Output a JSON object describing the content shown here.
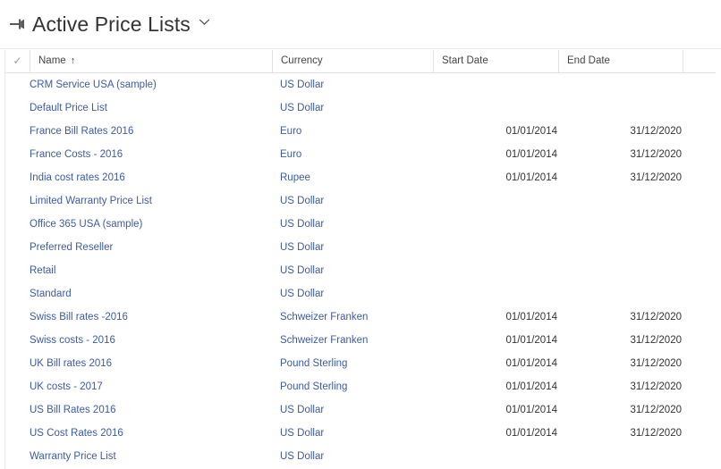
{
  "header": {
    "pin_icon": "pin-icon",
    "title": "Active Price Lists",
    "chevron_icon": "chevron-down-icon"
  },
  "grid": {
    "columns": {
      "select_all_icon": "checkmark-icon",
      "name": "Name",
      "sort_indicator": "↑",
      "currency": "Currency",
      "start_date": "Start Date",
      "end_date": "End Date"
    },
    "rows": [
      {
        "name": "CRM Service USA (sample)",
        "currency": "US Dollar",
        "start_date": "",
        "end_date": ""
      },
      {
        "name": "Default Price List",
        "currency": "US Dollar",
        "start_date": "",
        "end_date": ""
      },
      {
        "name": "France Bill Rates 2016",
        "currency": "Euro",
        "start_date": "01/01/2014",
        "end_date": "31/12/2020"
      },
      {
        "name": "France Costs - 2016",
        "currency": "Euro",
        "start_date": "01/01/2014",
        "end_date": "31/12/2020"
      },
      {
        "name": "India cost rates 2016",
        "currency": "Rupee",
        "start_date": "01/01/2014",
        "end_date": "31/12/2020"
      },
      {
        "name": "Limited Warranty Price List",
        "currency": "US Dollar",
        "start_date": "",
        "end_date": ""
      },
      {
        "name": "Office 365 USA (sample)",
        "currency": "US Dollar",
        "start_date": "",
        "end_date": ""
      },
      {
        "name": "Preferred Reseller",
        "currency": "US Dollar",
        "start_date": "",
        "end_date": ""
      },
      {
        "name": "Retail",
        "currency": "US Dollar",
        "start_date": "",
        "end_date": ""
      },
      {
        "name": "Standard",
        "currency": "US Dollar",
        "start_date": "",
        "end_date": ""
      },
      {
        "name": "Swiss Bill rates -2016",
        "currency": "Schweizer Franken",
        "start_date": "01/01/2014",
        "end_date": "31/12/2020"
      },
      {
        "name": "Swiss costs - 2016",
        "currency": "Schweizer Franken",
        "start_date": "01/01/2014",
        "end_date": "31/12/2020"
      },
      {
        "name": "UK Bill rates 2016",
        "currency": "Pound Sterling",
        "start_date": "01/01/2014",
        "end_date": "31/12/2020"
      },
      {
        "name": "UK costs - 2017",
        "currency": "Pound Sterling",
        "start_date": "01/01/2014",
        "end_date": "31/12/2020"
      },
      {
        "name": "US Bill Rates 2016",
        "currency": "US Dollar",
        "start_date": "01/01/2014",
        "end_date": "31/12/2020"
      },
      {
        "name": "US Cost Rates 2016",
        "currency": "US Dollar",
        "start_date": "01/01/2014",
        "end_date": "31/12/2020"
      },
      {
        "name": "Warranty Price List",
        "currency": "US Dollar",
        "start_date": "",
        "end_date": ""
      }
    ]
  },
  "colors": {
    "link": "#3a5ca4",
    "text": "#333333",
    "border": "#e2e2e2",
    "background": "#ffffff"
  }
}
